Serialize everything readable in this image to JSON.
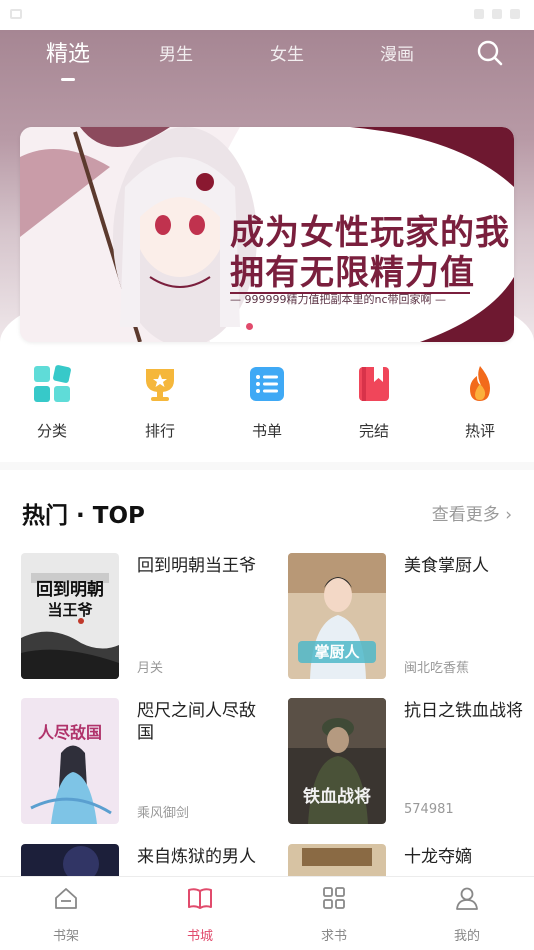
{
  "top_tabs": [
    "精选",
    "男生",
    "女生",
    "漫画"
  ],
  "banner": {
    "line1": "成为女性玩家的我",
    "line2": "拥有无限精力值",
    "subtitle": "— 999999精力值把副本里的nc带回家啊 —"
  },
  "categories": [
    {
      "label": "分类",
      "icon": "grid-icon",
      "color": "#37c9c9"
    },
    {
      "label": "排行",
      "icon": "trophy-icon",
      "color": "#f5b73b"
    },
    {
      "label": "书单",
      "icon": "list-icon",
      "color": "#3fa9f5"
    },
    {
      "label": "完结",
      "icon": "bookmark-book-icon",
      "color": "#f0465a"
    },
    {
      "label": "热评",
      "icon": "flame-icon",
      "color": "#f26a1b"
    }
  ],
  "section": {
    "title": "热门 · TOP",
    "more": "查看更多"
  },
  "books": [
    {
      "title": "回到明朝当王爷",
      "author": "月关"
    },
    {
      "title": "美食掌厨人",
      "author": "闽北吃香蕉"
    },
    {
      "title": "咫尺之间人尽敌国",
      "author": "乘风御剑"
    },
    {
      "title": "抗日之铁血战将",
      "author": "574981"
    },
    {
      "title": "来自炼狱的男人",
      "author": ""
    },
    {
      "title": "十龙夺嫡",
      "author": ""
    }
  ],
  "bottom_tabs": [
    {
      "label": "书架",
      "icon": "bookshelf-icon"
    },
    {
      "label": "书城",
      "icon": "open-book-icon"
    },
    {
      "label": "求书",
      "icon": "apps-icon"
    },
    {
      "label": "我的",
      "icon": "user-icon"
    }
  ],
  "colors": {
    "accent": "#e14b6c",
    "banner_text": "#7a1f3d"
  }
}
